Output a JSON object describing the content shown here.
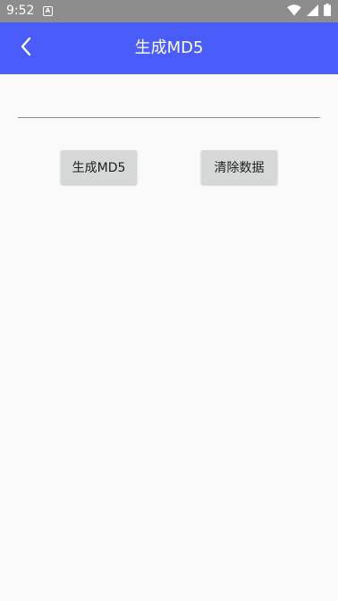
{
  "status_bar": {
    "time": "9:52",
    "notification_glyph": "A",
    "icons": [
      "wifi-icon",
      "signal-icon",
      "battery-icon"
    ]
  },
  "app_bar": {
    "title": "生成MD5",
    "back_icon": "back-arrow-icon",
    "color": "#4a5cfa"
  },
  "main": {
    "input": {
      "value": "",
      "placeholder": ""
    },
    "buttons": {
      "generate_label": "生成MD5",
      "clear_label": "清除数据"
    }
  }
}
